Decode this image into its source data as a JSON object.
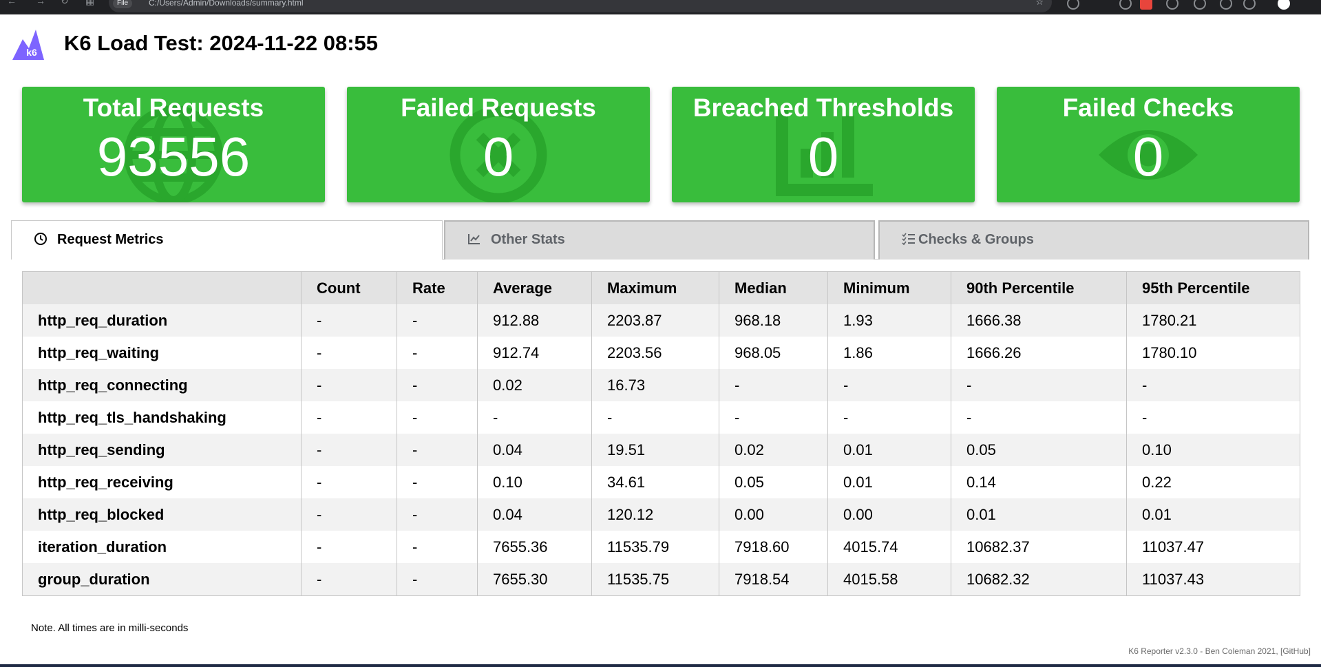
{
  "browser": {
    "url_chip": "File",
    "url": "C:/Users/Admin/Downloads/summary.html"
  },
  "header": {
    "logo_text": "k6",
    "title": "K6 Load Test: 2024-11-22 08:55"
  },
  "colors": {
    "card_green": "#39bd3c",
    "logo_purple": "#7d64ff",
    "header_row": "#e3e3e3",
    "stripe_row": "#f2f2f2"
  },
  "cards": [
    {
      "title": "Total Requests",
      "value": "93556",
      "icon": "globe-icon"
    },
    {
      "title": "Failed Requests",
      "value": "0",
      "icon": "x-circle-icon"
    },
    {
      "title": "Breached Thresholds",
      "value": "0",
      "icon": "bar-chart-icon"
    },
    {
      "title": "Failed Checks",
      "value": "0",
      "icon": "eye-icon"
    }
  ],
  "tabs": [
    {
      "label": "Request Metrics",
      "icon": "clock-icon",
      "active": true
    },
    {
      "label": "Other Stats",
      "icon": "line-chart-icon",
      "active": false
    },
    {
      "label": "Checks & Groups",
      "icon": "checklist-icon",
      "active": false
    }
  ],
  "table": {
    "columns": [
      "",
      "Count",
      "Rate",
      "Average",
      "Maximum",
      "Median",
      "Minimum",
      "90th Percentile",
      "95th Percentile"
    ],
    "rows": [
      [
        "http_req_duration",
        "-",
        "-",
        "912.88",
        "2203.87",
        "968.18",
        "1.93",
        "1666.38",
        "1780.21"
      ],
      [
        "http_req_waiting",
        "-",
        "-",
        "912.74",
        "2203.56",
        "968.05",
        "1.86",
        "1666.26",
        "1780.10"
      ],
      [
        "http_req_connecting",
        "-",
        "-",
        "0.02",
        "16.73",
        "-",
        "-",
        "-",
        "-"
      ],
      [
        "http_req_tls_handshaking",
        "-",
        "-",
        "-",
        "-",
        "-",
        "-",
        "-",
        "-"
      ],
      [
        "http_req_sending",
        "-",
        "-",
        "0.04",
        "19.51",
        "0.02",
        "0.01",
        "0.05",
        "0.10"
      ],
      [
        "http_req_receiving",
        "-",
        "-",
        "0.10",
        "34.61",
        "0.05",
        "0.01",
        "0.14",
        "0.22"
      ],
      [
        "http_req_blocked",
        "-",
        "-",
        "0.04",
        "120.12",
        "0.00",
        "0.00",
        "0.01",
        "0.01"
      ],
      [
        "iteration_duration",
        "-",
        "-",
        "7655.36",
        "11535.79",
        "7918.60",
        "4015.74",
        "10682.37",
        "11037.47"
      ],
      [
        "group_duration",
        "-",
        "-",
        "7655.30",
        "11535.75",
        "7918.54",
        "4015.58",
        "10682.32",
        "11037.43"
      ]
    ]
  },
  "note": "Note. All times are in milli-seconds",
  "footer": {
    "credit": "K6 Reporter v2.3.0 - Ben Coleman 2021, ",
    "link": "[GitHub]"
  }
}
